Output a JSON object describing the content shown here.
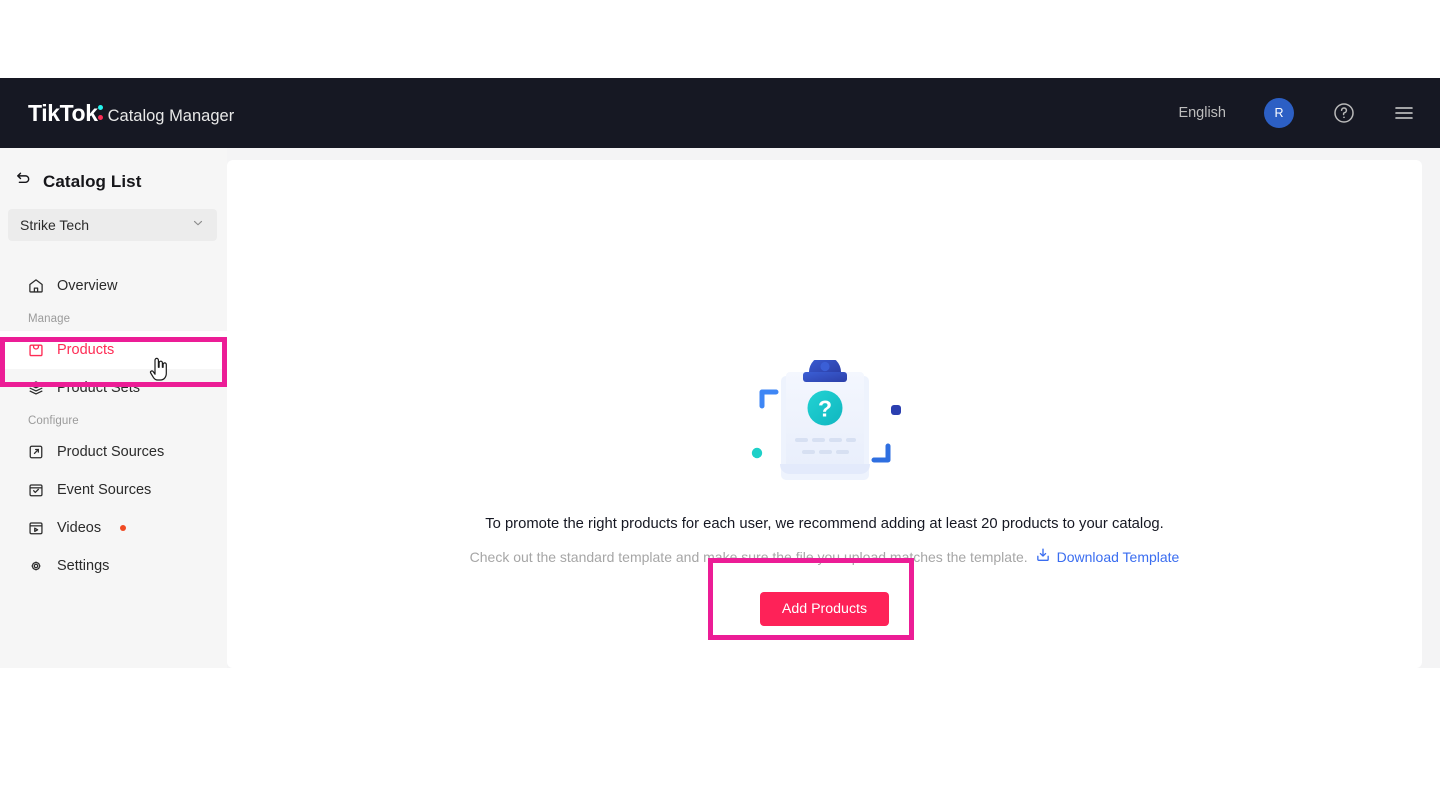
{
  "header": {
    "logo_text": "TikTok",
    "product_name": "Catalog Manager",
    "language": "English",
    "avatar_initial": "R",
    "help_icon": "question-circle-icon",
    "menu_icon": "hamburger-menu-icon",
    "bg_color": "#161823",
    "logo_cyan": "#25F4EE",
    "logo_pink": "#FE2C55"
  },
  "sidebar": {
    "back_label": "Catalog List",
    "back_icon": "back-arrow-icon",
    "org_selector": {
      "value": "Strike Tech",
      "chevron_icon": "chevron-down-icon"
    },
    "items": [
      {
        "label": "Overview",
        "icon": "home-icon",
        "active": false,
        "group": null
      },
      {
        "label": "Products",
        "icon": "shopping-bag-icon",
        "active": true,
        "group": "Manage"
      },
      {
        "label": "Product Sets",
        "icon": "layers-icon",
        "active": false,
        "group": "Manage"
      },
      {
        "label": "Product Sources",
        "icon": "product-source-icon",
        "active": false,
        "group": "Configure"
      },
      {
        "label": "Event Sources",
        "icon": "event-source-icon",
        "active": false,
        "group": "Configure"
      },
      {
        "label": "Videos",
        "icon": "video-icon",
        "active": false,
        "group": "Configure",
        "badge_dot": true
      },
      {
        "label": "Settings",
        "icon": "settings-gear-icon",
        "active": false,
        "group": "Configure"
      }
    ],
    "groups": {
      "manage": "Manage",
      "configure": "Configure"
    },
    "active_color": "#FE2C55",
    "highlight_border_color": "#ec1d96"
  },
  "main": {
    "illustration": {
      "name": "empty-state-clipboard-question-illustration",
      "question_mark": "?",
      "accent_teal": "#17C3C3",
      "accent_blue": "#2B4BCB"
    },
    "message_primary": "To promote the right products for each user, we recommend adding at least 20 products to your catalog.",
    "message_secondary": "Check out the standard template and make sure the file you upload matches the template.",
    "download_link": "Download Template",
    "download_icon": "download-icon",
    "add_products_button": "Add Products",
    "button_color": "#FE2258",
    "annotation_color": "#ec1d96"
  }
}
